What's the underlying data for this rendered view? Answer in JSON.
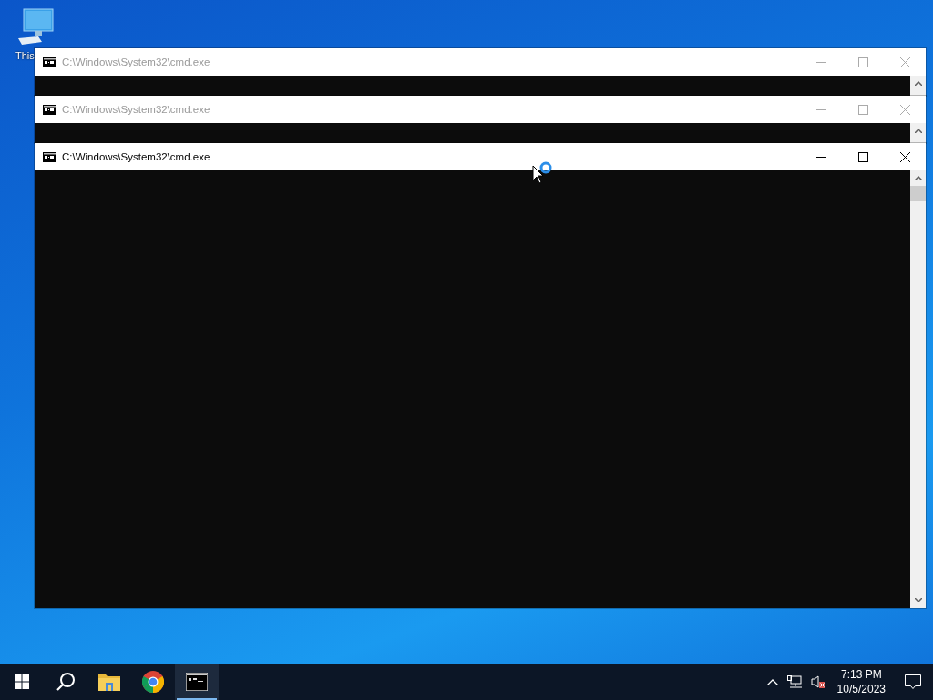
{
  "desktop": {
    "icons": [
      {
        "label": "This"
      }
    ]
  },
  "windows": [
    {
      "title": "C:\\Windows\\System32\\cmd.exe",
      "active": false
    },
    {
      "title": "C:\\Windows\\System32\\cmd.exe",
      "active": false
    },
    {
      "title": "C:\\Windows\\System32\\cmd.exe",
      "active": true
    }
  ],
  "taskbar": {
    "apps": [
      {
        "kind": "start",
        "running": false
      },
      {
        "kind": "search",
        "running": false
      },
      {
        "kind": "explorer",
        "running": false
      },
      {
        "kind": "chrome",
        "running": false
      },
      {
        "kind": "cmd",
        "running": true
      }
    ],
    "tray": {
      "volume_muted": true,
      "time": "7:13 PM",
      "date": "10/5/2023"
    }
  }
}
